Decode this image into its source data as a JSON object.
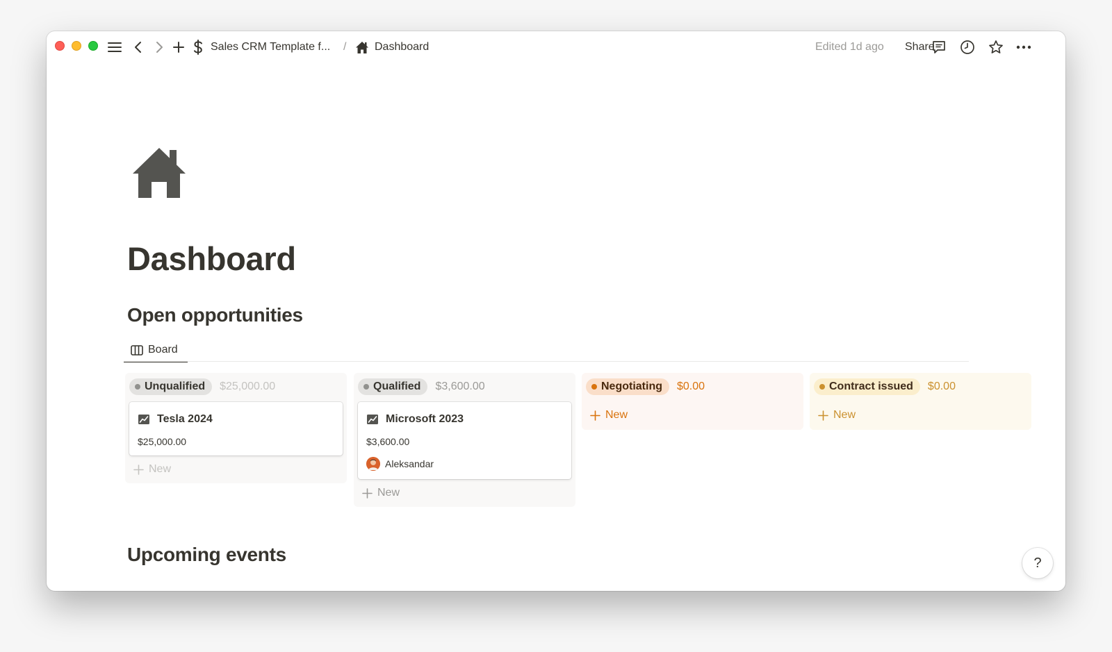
{
  "titlebar": {
    "breadcrumb_parent": "Sales CRM Template f...",
    "breadcrumb_separator": "/",
    "breadcrumb_current": "Dashboard",
    "edited": "Edited 1d ago",
    "share_label": "Share"
  },
  "page": {
    "title": "Dashboard",
    "section_open": "Open opportunities",
    "view_tab": "Board",
    "section_events": "Upcoming events",
    "help_label": "?"
  },
  "board": {
    "new_label": "New",
    "columns": [
      {
        "name": "Unqualified",
        "sum": "$25,000.00",
        "cards": [
          {
            "title": "Tesla 2024",
            "amount": "$25,000.00"
          }
        ]
      },
      {
        "name": "Qualified",
        "sum": "$3,600.00",
        "cards": [
          {
            "title": "Microsoft 2023",
            "amount": "$3,600.00",
            "person": "Aleksandar"
          }
        ]
      },
      {
        "name": "Negotiating",
        "sum": "$0.00",
        "cards": []
      },
      {
        "name": "Contract issued",
        "sum": "$0.00",
        "cards": []
      }
    ]
  },
  "colors": {
    "gray_bg": "#f9f8f7",
    "gray_pill": "#e3e2e0",
    "gray_dot": "#91918e",
    "orange_bg": "#fdf6f3",
    "orange_pill": "#fadec9",
    "orange_dot": "#d9730d",
    "orange_text": "#d9730d",
    "yellow_bg": "#fdf9ee",
    "yellow_pill": "#fbeecc",
    "yellow_dot": "#cb912f",
    "yellow_text": "#cb912f"
  }
}
